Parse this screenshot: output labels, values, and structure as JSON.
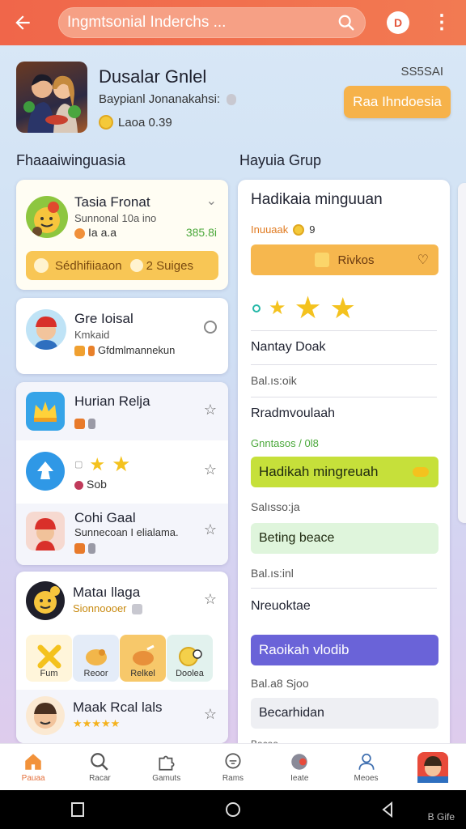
{
  "topbar": {
    "search_placeholder": "Ingmtsonial Inderchs ...",
    "profile_initial": "D"
  },
  "header": {
    "title": "Dusalar Gnlel",
    "subtitle": "Baypianl Jonanakahsi:",
    "meta": "Laoa 0.39",
    "count": "SS5SAI",
    "primary_button": "Raa Ihndoesia"
  },
  "sections": {
    "left_title": "Fhaaaiwinguasia",
    "right_title": "Hayuia Grup"
  },
  "left": {
    "card1": {
      "title": "Tasia Fronat",
      "subtitle": "Sunnonal 10a ino",
      "meta": "Ia a.a",
      "price": "385.8i",
      "pill_left": "Sédhifiiaaon",
      "pill_right": "2 Suiges"
    },
    "card2": {
      "title": "Gre Ioisal",
      "subtitle": "Kmkaid",
      "meta": "Gfdmlmannekun"
    },
    "row3": {
      "title": "Hurian Relja"
    },
    "row4": {
      "meta": "Sob"
    },
    "row5": {
      "title": "Cohi Gaal",
      "subtitle": "Sunnecoan I elialama."
    },
    "row6": {
      "title": "Mataı llaga",
      "subtitle": "Sionnoooer"
    },
    "tiles": [
      "Fum",
      "Reoor",
      "Relkel",
      "Doolea"
    ],
    "row7": {
      "title": "Maak Rcal lals"
    }
  },
  "right": {
    "title": "Hadikaia minguuan",
    "meta": "Inuuaak",
    "meta_num": "9",
    "orange_button": "Rivkos",
    "line1": "Nantay Doak",
    "label1": "Bal.ıs:oik",
    "line2": "Rradmvoulaah",
    "green_label": "Gnntasos / 0l8",
    "green_button": "Hadikah mingreuah",
    "label2": "Salısso:ja",
    "light_button": "Beting beace",
    "label3": "Bal.ıs:inl",
    "line3": "Nreuoktae",
    "purple_button": "Raoikah vlodib",
    "label4": "Bal.a8 Sjoo",
    "gray_button": "Becarhidan",
    "label5": "Bacaa..."
  },
  "bottom_nav": [
    {
      "label": "Pauaa",
      "icon": "home-icon"
    },
    {
      "label": "Racar",
      "icon": "search-icon"
    },
    {
      "label": "Gamuts",
      "icon": "puzzle-icon"
    },
    {
      "label": "Rams",
      "icon": "chat-icon"
    },
    {
      "label": "Ieate",
      "icon": "record-icon"
    },
    {
      "label": "Meoes",
      "icon": "user-icon"
    },
    {
      "label": "",
      "icon": "avatar-icon"
    }
  ],
  "system_text": "B Gife",
  "colors": {
    "topbar": "#f0664a",
    "primary": "#f6b24a",
    "green": "#c5e03a",
    "purple": "#6a63d8",
    "active_nav": "#e4703c"
  }
}
